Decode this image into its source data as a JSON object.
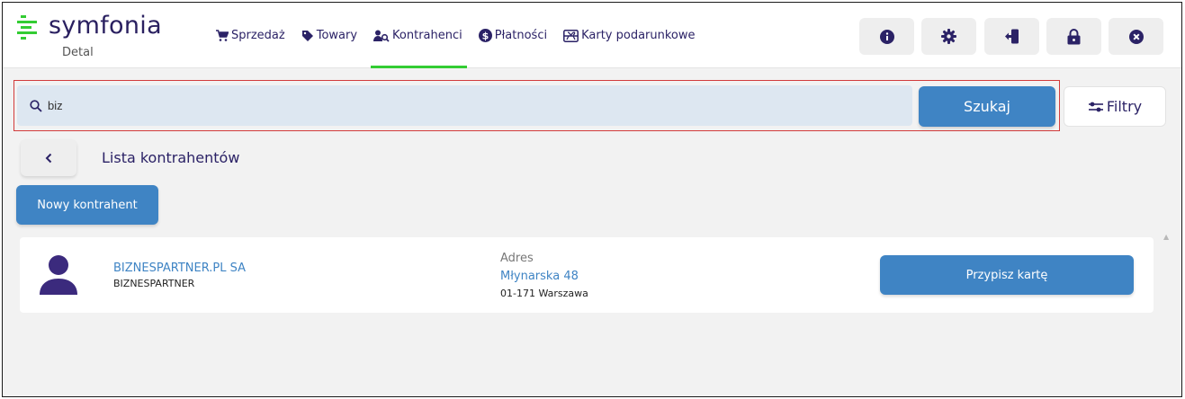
{
  "app": {
    "logo_name": "symfonia",
    "logo_sub": "Detal",
    "accent_green": "#33cc33",
    "primary_blue": "#3f84c4"
  },
  "nav": {
    "items": [
      {
        "label": "Sprzedaż",
        "icon": "cart-icon"
      },
      {
        "label": "Towary",
        "icon": "tag-icon"
      },
      {
        "label": "Kontrahenci",
        "icon": "contacts-search-icon",
        "active": true
      },
      {
        "label": "Płatności",
        "icon": "dollar-circle-icon"
      },
      {
        "label": "Karty podarunkowe",
        "icon": "gift-card-icon"
      }
    ]
  },
  "header_buttons": [
    {
      "icon": "info-icon"
    },
    {
      "icon": "gear-icon"
    },
    {
      "icon": "logout-icon"
    },
    {
      "icon": "lock-icon"
    },
    {
      "icon": "close-circle-icon"
    }
  ],
  "search": {
    "value": "biz",
    "button_label": "Szukaj",
    "filters_label": "Filtry"
  },
  "list": {
    "title": "Lista kontrahentów",
    "new_button_label": "Nowy kontrahent"
  },
  "contractor": {
    "name": "BIZNESPARTNER.PL SA",
    "short_name": "BIZNESPARTNER",
    "address_label": "Adres",
    "street": "Młynarska 48",
    "city": "01-171 Warszawa",
    "action_label": "Przypisz kartę"
  }
}
